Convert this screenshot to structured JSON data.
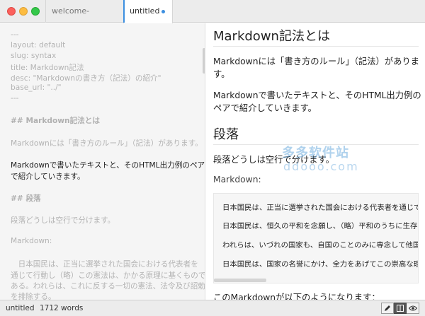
{
  "tabs": [
    {
      "label": "welcome-guide.md"
    },
    {
      "label": "untitled"
    }
  ],
  "editor": {
    "lines": [
      "---",
      "layout: default",
      "slug: syntax",
      "title: Markdown記法",
      "desc: \"Markdownの書き方（記法）の紹介\"",
      "base_url: \"../\"",
      "---",
      "## Markdown記法とは",
      "Markdownには「書き方のルール」（記法）があります。",
      "Markdownで書いたテキストと、そのHTML出力例のペア",
      "で紹介していきます。",
      "## 段落",
      "段落どうしは空行で分けます。",
      "Markdown:",
      "　日本国民は、正当に選挙された国会における代表者を",
      "通じて行動し（略）この憲法は、かかる原理に基くもので",
      "ある。われらは、これに反する一切の憲法、法令及び詔勅",
      "を排除する。"
    ]
  },
  "preview": {
    "h1_a": "Markdown記法とは",
    "p1_a": "Markdownには「書き方のルール」（記法）がありま",
    "p1_b": "す。",
    "p2_a": "Markdownで書いたテキストと、そのHTML出力例の",
    "p2_b": "ペアで紹介していきます。",
    "h1_b": "段落",
    "p3": "段落どうしは空行で分けます。",
    "p4": "Markdown:",
    "code": [
      "日本国民は、正当に選挙された国会における代表者を通じて行",
      "日本国民は、恒久の平和を念願し、（略）平和のうちに生存す",
      "われらは、いづれの国家も、自国のことのみに専念して他国を",
      "日本国民は、国家の名誉にかけ、全力をあげてこの崇高な理想"
    ],
    "p5": "このMarkdownが以下のようになります："
  },
  "watermark": {
    "text": "多多软件站",
    "url": "ddooo.com"
  },
  "status": {
    "filename": "untitled",
    "words": "1712 words"
  },
  "icons": {
    "edit": "pencil-icon",
    "split": "split-view-icon",
    "preview": "eye-icon"
  }
}
